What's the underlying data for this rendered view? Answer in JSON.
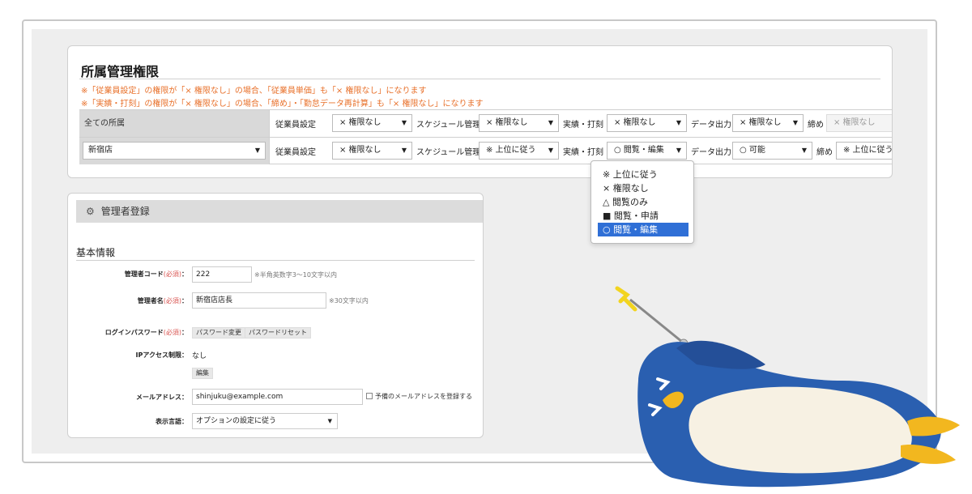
{
  "affiliation_panel": {
    "title": "所属管理権限",
    "notes": [
      "※「従業員設定」の権限が「× 権限なし」の場合、「従業員単価」も「× 権限なし」になります",
      "※「実績・打刻」の権限が「× 権限なし」の場合、「締め」・「勤怠データ再計算」も「× 権限なし」になります"
    ],
    "rows": [
      {
        "affiliation": "全ての所属",
        "perms": [
          {
            "label": "従業員設定",
            "value": "× 権限なし"
          },
          {
            "label": "スケジュール管理",
            "value": "× 権限なし"
          },
          {
            "label": "実績・打刻",
            "value": "× 権限なし"
          },
          {
            "label": "データ出力",
            "value": "× 権限なし"
          },
          {
            "label": "締め",
            "value": "× 権限なし"
          }
        ]
      },
      {
        "affiliation": "新宿店",
        "perms": [
          {
            "label": "従業員設定",
            "value": "× 権限なし"
          },
          {
            "label": "スケジュール管理",
            "value": "※ 上位に従う"
          },
          {
            "label": "実績・打刻",
            "value": "○ 閲覧・編集"
          },
          {
            "label": "データ出力",
            "value": "○ 可能"
          },
          {
            "label": "締め",
            "value": "※ 上位に従う"
          }
        ]
      }
    ],
    "dropdown_options": [
      "※ 上位に従う",
      "× 権限なし",
      "△ 閲覧のみ",
      "■ 閲覧・申請",
      "○ 閲覧・編集"
    ],
    "dropdown_selected_index": 4
  },
  "admin_panel": {
    "header": "管理者登録",
    "section": "基本情報",
    "required": "(必須)",
    "fields": {
      "code_label": "管理者コード",
      "code_value": "222",
      "code_hint": "※半角英数字3～10文字以内",
      "name_label": "管理者名",
      "name_value": "新宿店店長",
      "name_hint": "※30文字以内",
      "password_label": "ログインパスワード",
      "password_change": "パスワード変更",
      "password_reset": "パスワードリセット",
      "ip_label": "IPアクセス制限",
      "ip_value": "なし",
      "ip_edit": "編集",
      "email_label": "メールアドレス",
      "email_value": "shinjuku@example.com",
      "email_spare": "予備のメールアドレスを登録する",
      "lang_label": "表示言語",
      "lang_value": "オプションの設定に従う"
    }
  },
  "colors": {
    "note_orange": "#e8702a",
    "selected_blue": "#2f6fd6",
    "penguin_blue": "#2a5fb0",
    "penguin_beak": "#f2b71f"
  }
}
